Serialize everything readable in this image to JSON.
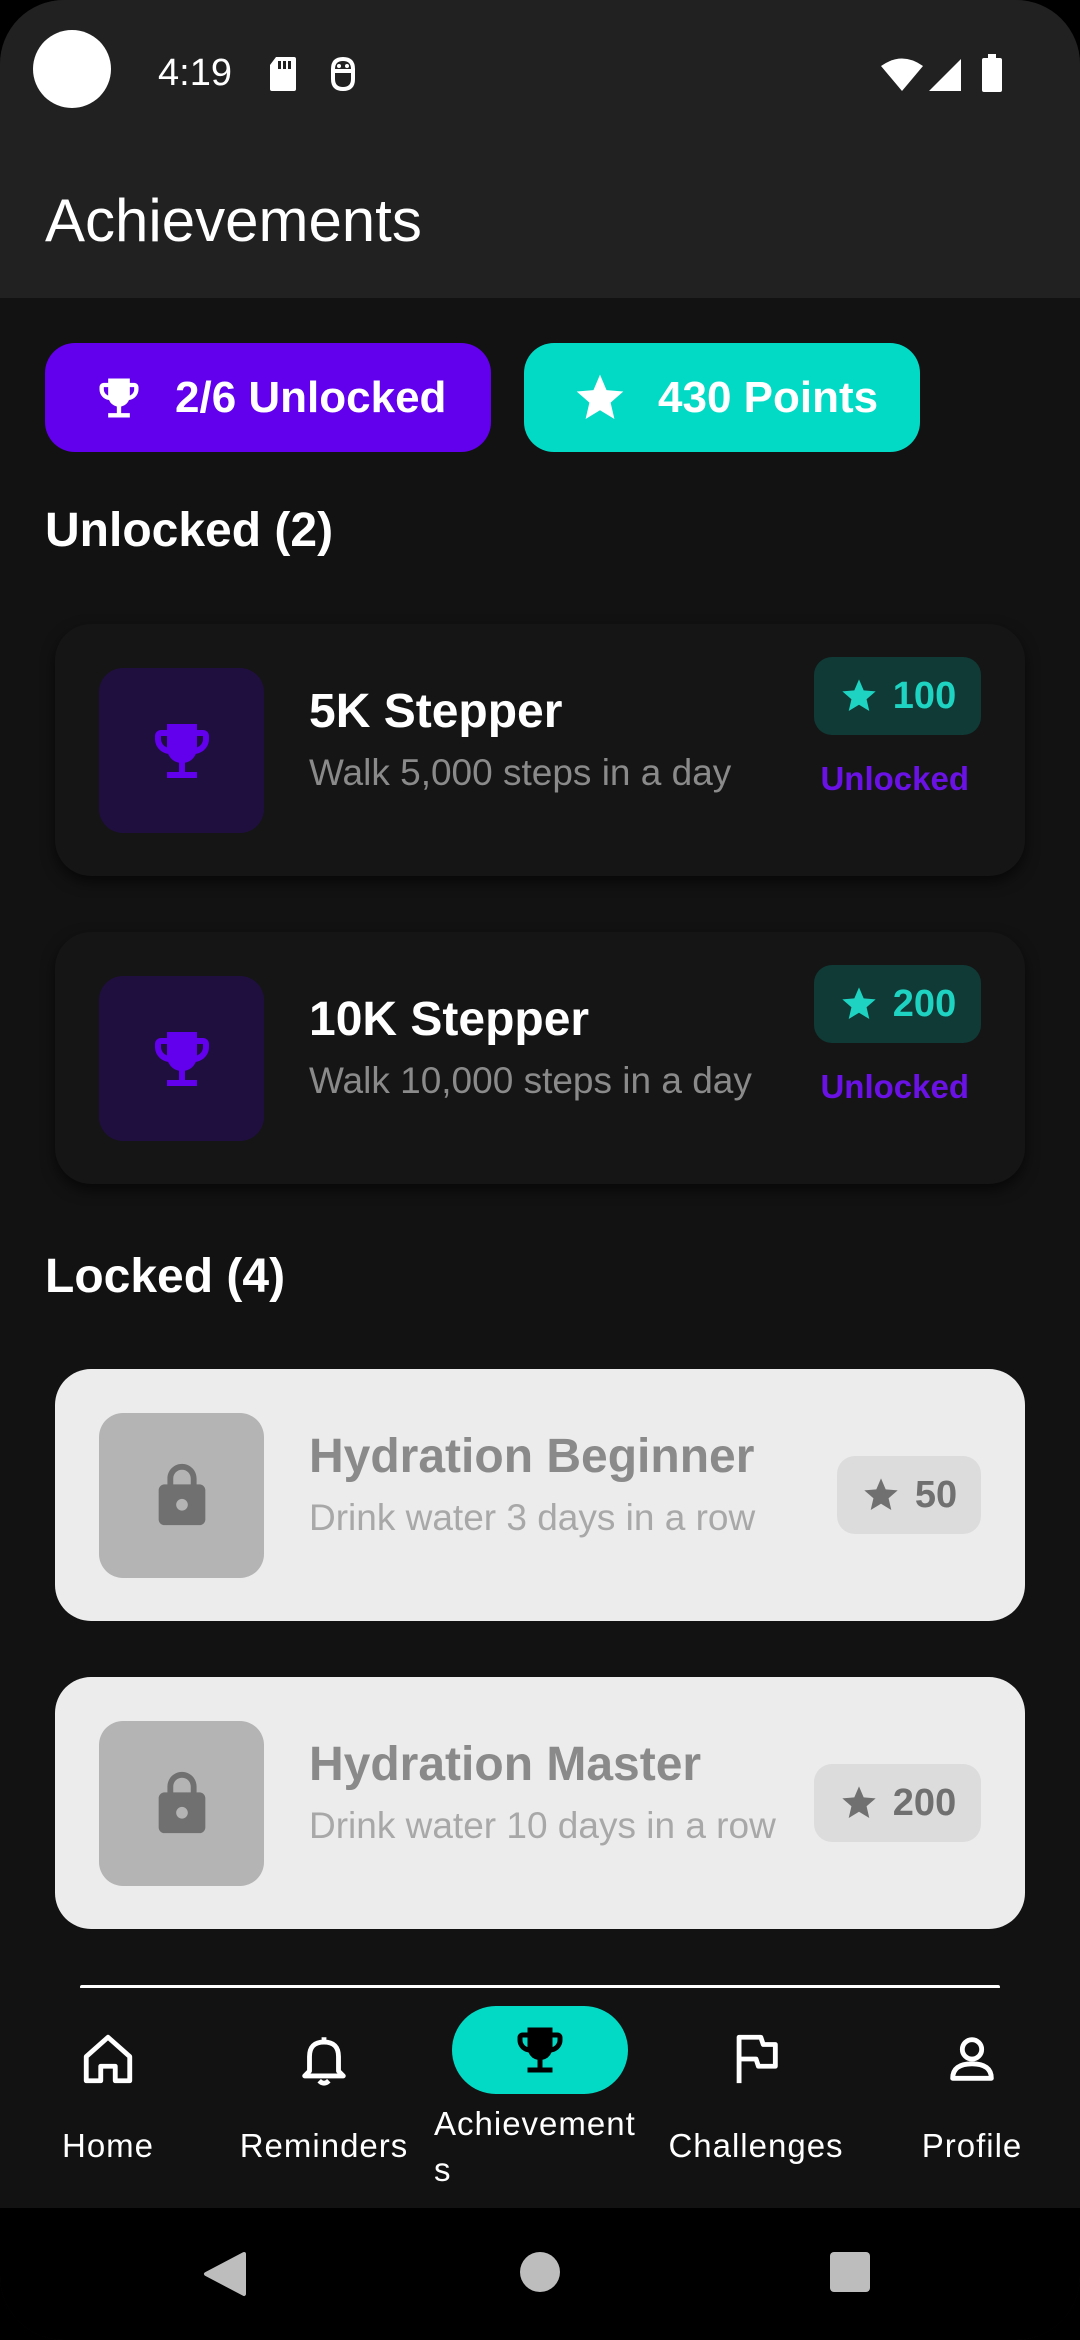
{
  "status_bar": {
    "time": "4:19"
  },
  "app_bar": {
    "title": "Achievements"
  },
  "summary": {
    "unlocked_chip": "2/6 Unlocked",
    "points_chip": "430 Points"
  },
  "sections": {
    "unlocked_title": "Unlocked (2)",
    "locked_title": "Locked (4)"
  },
  "unlocked": [
    {
      "title": "5K Stepper",
      "description": "Walk 5,000 steps in a day",
      "points": "100",
      "state": "Unlocked"
    },
    {
      "title": "10K Stepper",
      "description": "Walk 10,000 steps in a day",
      "points": "200",
      "state": "Unlocked"
    }
  ],
  "locked": [
    {
      "title": "Hydration Beginner",
      "description": "Drink water 3 days in a row",
      "points": "50"
    },
    {
      "title": "Hydration Master",
      "description": "Drink water 10 days in a row",
      "points": "200"
    }
  ],
  "bottom_nav": {
    "items": [
      {
        "label": "Home",
        "icon": "home-icon"
      },
      {
        "label": "Reminders",
        "icon": "bell-icon"
      },
      {
        "label": "Achievement\ns",
        "icon": "trophy-icon",
        "active": true
      },
      {
        "label": "Challenges",
        "icon": "flag-icon"
      },
      {
        "label": "Profile",
        "icon": "person-icon"
      }
    ]
  },
  "colors": {
    "primary": "#6200ee",
    "secondary": "#03dac5",
    "background": "#121212",
    "surface": "#212121"
  }
}
